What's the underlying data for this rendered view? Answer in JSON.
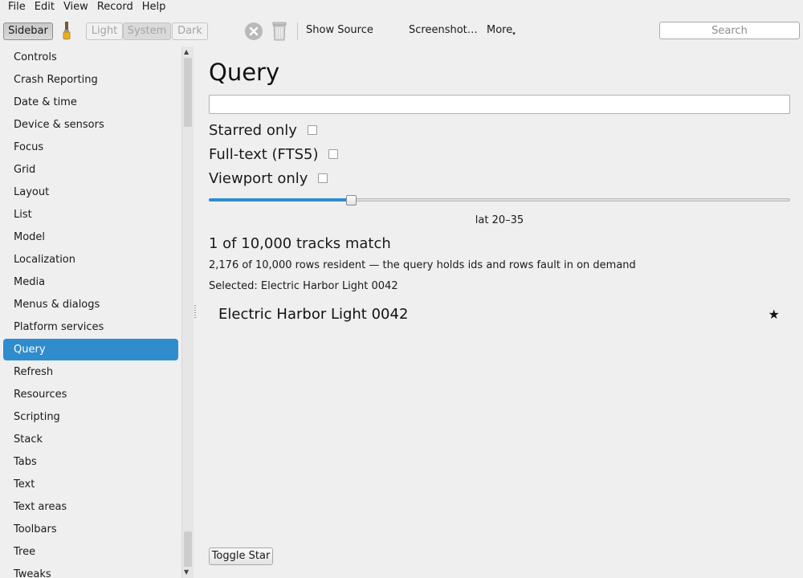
{
  "menubar": {
    "items": [
      "File",
      "Edit",
      "View",
      "Record",
      "Help"
    ]
  },
  "toolbar": {
    "sidebar_label": "Sidebar",
    "brush_icon": "paintbrush-icon",
    "theme": {
      "light": "Light",
      "system": "System",
      "dark": "Dark",
      "selected": "System"
    },
    "stop_icon": "stop-circle-icon",
    "trash_icon": "trash-icon",
    "show_source_label": "Show Source",
    "screenshot_label": "Screenshot…",
    "more_label": "More",
    "search_placeholder": "Search"
  },
  "sidebar": {
    "selected": "Query",
    "items": [
      "Controls",
      "Crash Reporting",
      "Date & time",
      "Device & sensors",
      "Focus",
      "Grid",
      "Layout",
      "List",
      "Model",
      "Localization",
      "Media",
      "Menus & dialogs",
      "Platform services",
      "Query",
      "Refresh",
      "Resources",
      "Scripting",
      "Stack",
      "Tabs",
      "Text",
      "Text areas",
      "Toolbars",
      "Tree",
      "Tweaks"
    ]
  },
  "main": {
    "title": "Query",
    "query_value": "",
    "filters": [
      {
        "label": "Starred only",
        "checked": false
      },
      {
        "label": "Full-text (FTS5)",
        "checked": false
      },
      {
        "label": "Viewport only",
        "checked": false
      }
    ],
    "slider": {
      "value_fraction": 0.24,
      "label": "lat 20–35"
    },
    "match_text": "1 of 10,000 tracks match",
    "resident_text": "2,176 of 10,000 rows resident — the query holds ids and rows fault in on demand",
    "selected_text": "Selected: Electric Harbor Light 0042",
    "results": [
      {
        "name": "Electric Harbor Light 0042",
        "starred": true,
        "star_glyph": "★"
      }
    ],
    "toggle_star_label": "Toggle Star"
  },
  "colors": {
    "accent": "#2f8ccd"
  }
}
